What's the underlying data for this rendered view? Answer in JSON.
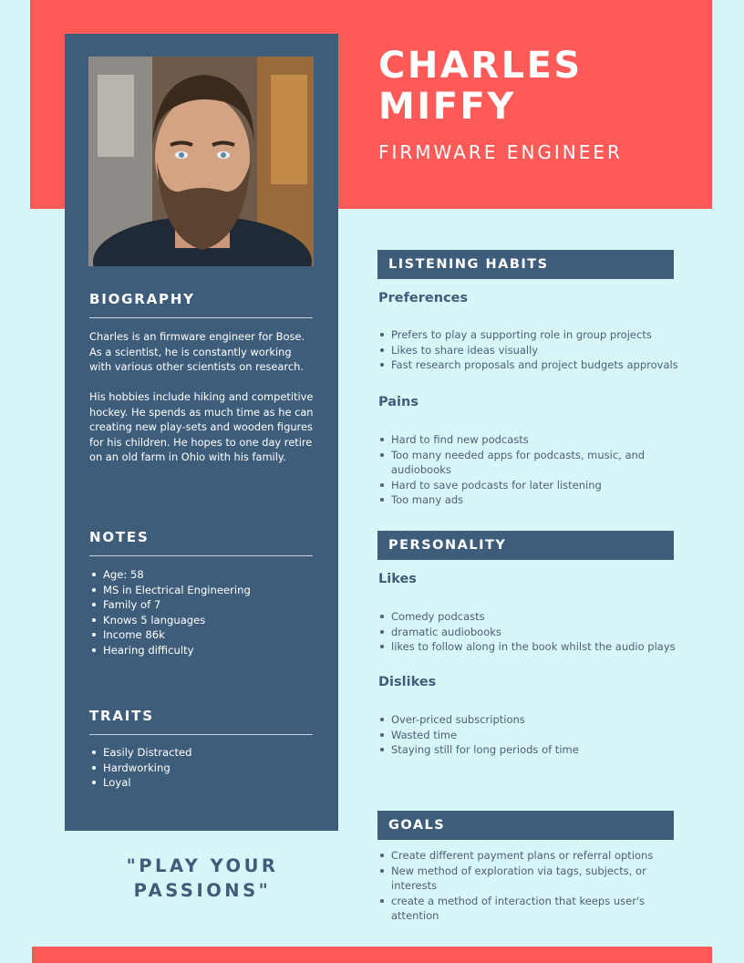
{
  "persona": {
    "name_line1": "CHARLES",
    "name_line2": "MIFFY",
    "job_title": "FIRMWARE ENGINEER"
  },
  "sidebar": {
    "biography": {
      "heading": "BIOGRAPHY",
      "paragraph1": "Charles is an firmware engineer for Bose. As a scientist, he is constantly working with various other scientists on research.",
      "paragraph2": "His hobbies include hiking and competitive hockey. He spends as much time as he can creating new play-sets and wooden figures for his children. He hopes to one day retire on an old farm in Ohio with his family."
    },
    "notes": {
      "heading": "NOTES",
      "items": [
        "Age: 58",
        "MS in Electrical Engineering",
        "Family of 7",
        "Knows 5 languages",
        "Income 86k",
        "Hearing difficulty"
      ]
    },
    "traits": {
      "heading": "TRAITS",
      "items": [
        "Easily Distracted",
        "Hardworking",
        "Loyal"
      ]
    }
  },
  "quote": {
    "line1": "\"PLAY YOUR",
    "line2": "PASSIONS\""
  },
  "listening_habits": {
    "heading": "LISTENING HABITS",
    "preferences": {
      "heading": "Preferences",
      "items": [
        "Prefers to play a supporting role in group projects",
        "Likes to share ideas visually",
        "Fast research proposals and project budgets approvals"
      ]
    },
    "pains": {
      "heading": "Pains",
      "items": [
        "Hard to find new podcasts",
        "Too many needed apps for podcasts, music, and audiobooks",
        "Hard to save podcasts for later listening",
        "Too many ads"
      ]
    }
  },
  "personality": {
    "heading": "PERSONALITY",
    "likes": {
      "heading": "Likes",
      "items": [
        "Comedy podcasts",
        "dramatic audiobooks",
        "likes to follow along in the book whilst the audio plays"
      ]
    },
    "dislikes": {
      "heading": "Dislikes",
      "items": [
        "Over-priced subscriptions",
        "Wasted time",
        "Staying still for long periods of time"
      ]
    }
  },
  "goals": {
    "heading": "GOALS",
    "items": [
      "Create different payment plans or referral options",
      "New method of exploration via tags, subjects, or interests",
      "create a method of interaction that keeps user's attention"
    ]
  },
  "colors": {
    "accent_coral": "#fd5a58",
    "navy": "#3d5d7b",
    "background": "#d8f6f8"
  }
}
